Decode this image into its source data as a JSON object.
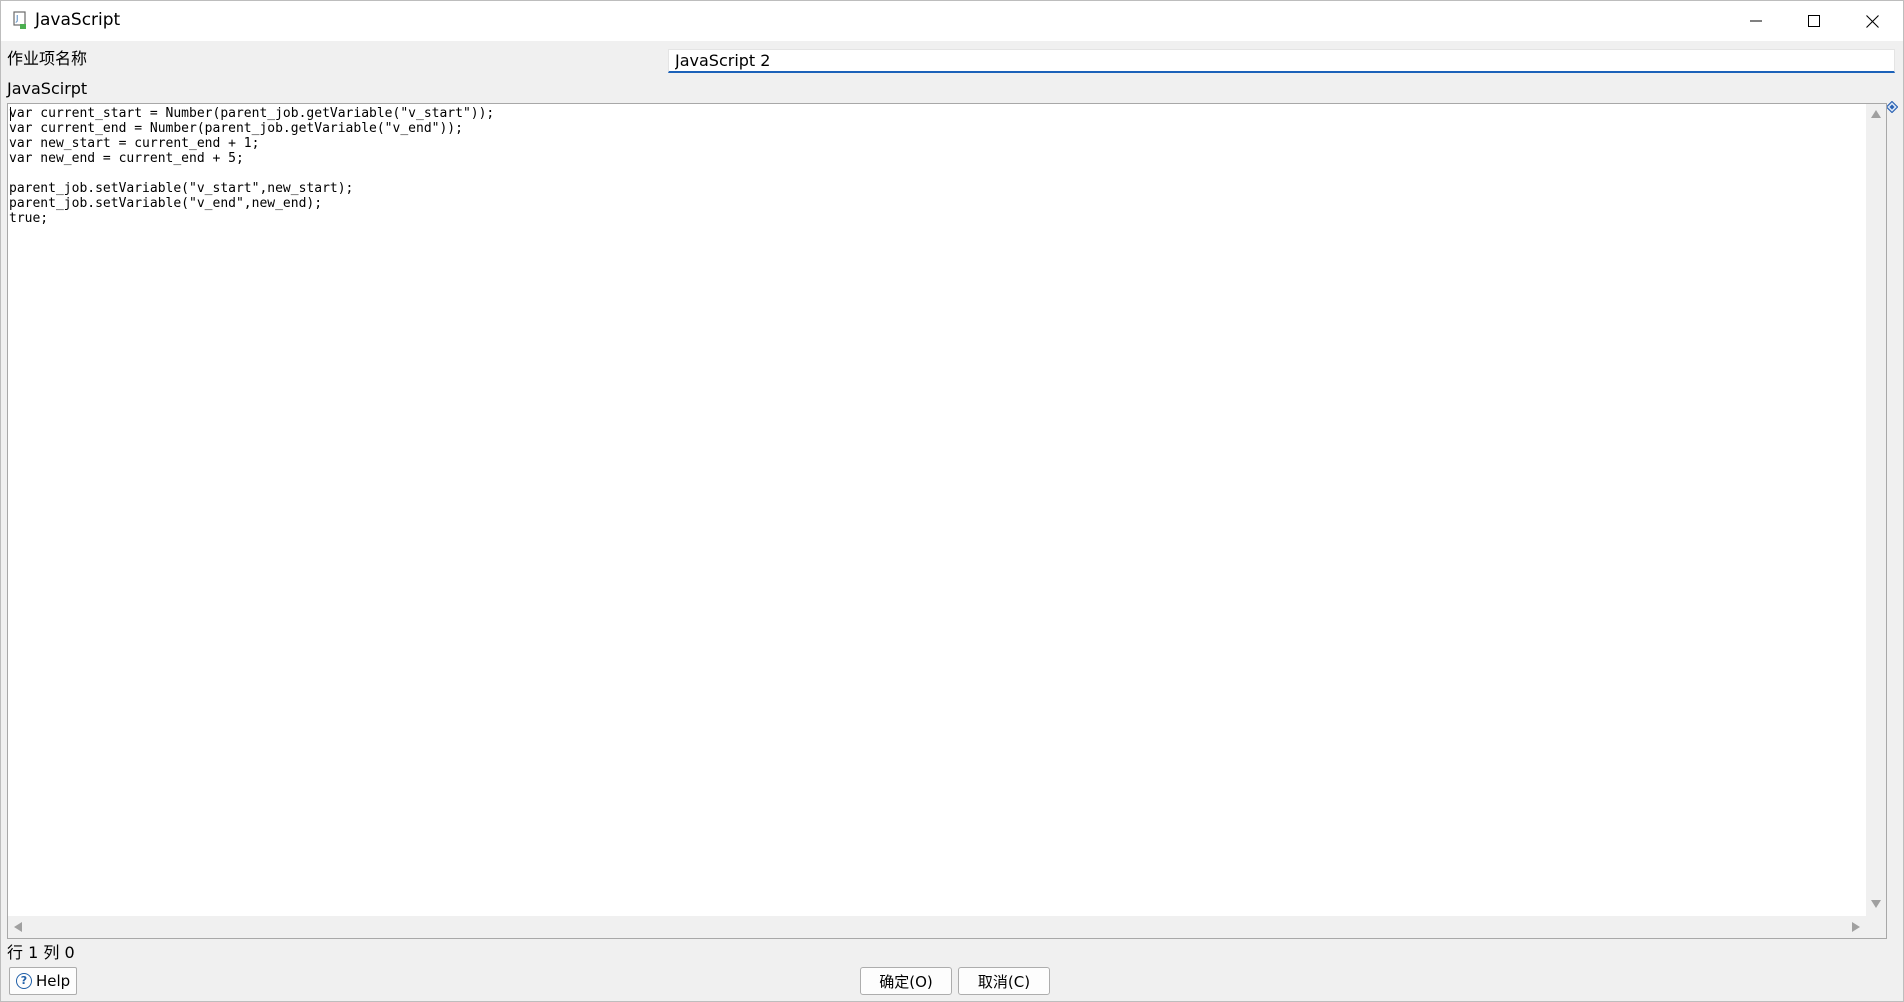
{
  "window": {
    "title": "JavaScript",
    "icon": "javascript-job-icon",
    "controls": [
      "minimize-icon",
      "maximize-icon",
      "close-icon"
    ]
  },
  "form": {
    "name_label": "作业项名称",
    "name_value": "JavaScript 2",
    "script_label": "JavaScirpt"
  },
  "editor": {
    "code": "var current_start = Number(parent_job.getVariable(\"v_start\"));\nvar current_end = Number(parent_job.getVariable(\"v_end\"));\nvar new_start = current_end + 1;\nvar new_end = current_end + 5;\n\nparent_job.setVariable(\"v_start\",new_start);\nparent_job.setVariable(\"v_end\",new_end);\ntrue;"
  },
  "status": {
    "position": "行 1 列 0"
  },
  "buttons": {
    "help": "Help",
    "ok": "确定(O)",
    "cancel": "取消(C)"
  },
  "colors": {
    "accent": "#1c62b9",
    "background": "#f0f0f0",
    "help_icon": "#1f5fa8"
  }
}
